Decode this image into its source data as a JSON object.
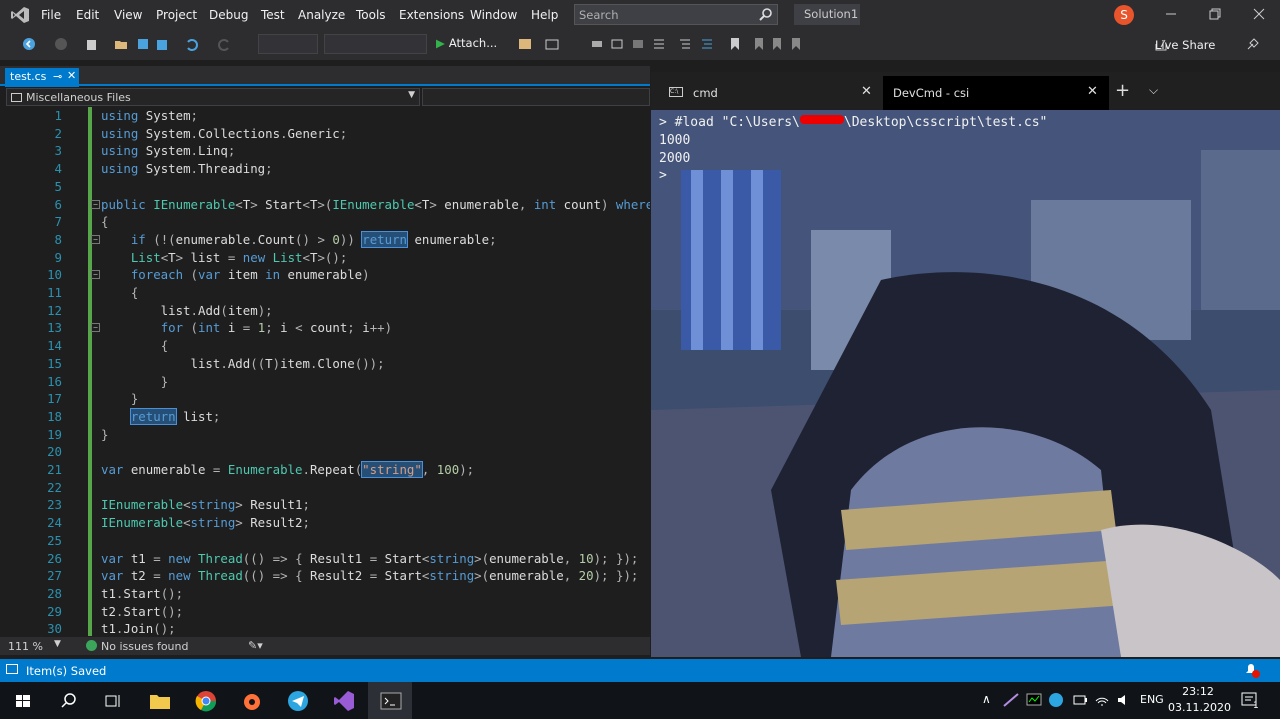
{
  "menubar": {
    "items": [
      "File",
      "Edit",
      "View",
      "Project",
      "Debug",
      "Test",
      "Analyze",
      "Tools",
      "Extensions",
      "Window",
      "Help"
    ],
    "search_placeholder": "Search",
    "solution": "Solution1",
    "avatar_letter": "S"
  },
  "toolbar": {
    "attach_label": "Attach...",
    "live_share_label": "Live Share"
  },
  "editor": {
    "tab_label": "test.cs",
    "nav_label": "Miscellaneous Files",
    "zoom": "111 %",
    "issues": "No issues found"
  },
  "statusbar": {
    "message": "Item(s) Saved"
  },
  "terminal": {
    "tabs": [
      "cmd",
      "DevCmd - csi"
    ],
    "lines": [
      "> #load \"C:\\Users\\",
      "1000",
      "2000",
      ">"
    ],
    "path_tail": "\\Desktop\\csscript\\test.cs\""
  },
  "taskbar": {
    "lang": "ENG",
    "time": "23:12",
    "date": "03.11.2020"
  },
  "code_lines": [
    "using System;",
    "using System.Collections.Generic;",
    "using System.Linq;",
    "using System.Threading;",
    "",
    "public IEnumerable<T> Start<T>(IEnumerable<T> enumerable, int count) where",
    "{",
    "    if (!(enumerable.Count() > 0)) return enumerable;",
    "    List<T> list = new List<T>();",
    "    foreach (var item in enumerable)",
    "    {",
    "        list.Add(item);",
    "        for (int i = 1; i < count; i++)",
    "        {",
    "            list.Add((T)item.Clone());",
    "        }",
    "    }",
    "    return list;",
    "}",
    "",
    "var enumerable = Enumerable.Repeat(\"string\", 100);",
    "",
    "IEnumerable<string> Result1;",
    "IEnumerable<string> Result2;",
    "",
    "var t1 = new Thread(() => { Result1 = Start<string>(enumerable, 10); });",
    "var t2 = new Thread(() => { Result2 = Start<string>(enumerable, 20); });",
    "t1.Start();",
    "t2.Start();",
    "t1.Join();"
  ]
}
